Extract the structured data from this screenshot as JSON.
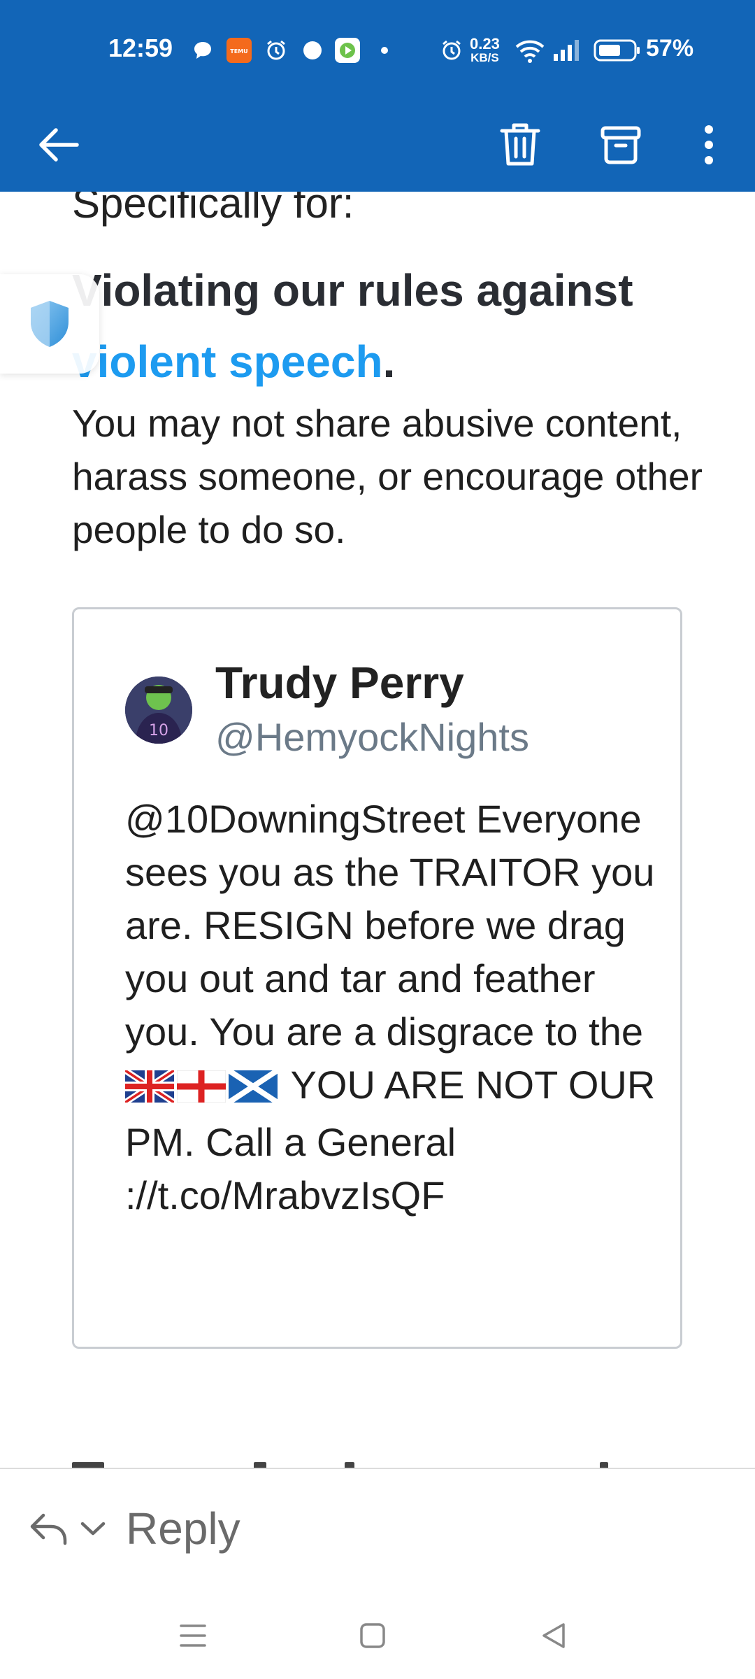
{
  "status_bar": {
    "time": "12:59",
    "net_speed_value": "0.23",
    "net_speed_unit": "KB/S",
    "battery_percent": "57%",
    "icons": [
      "chat-bubble-icon",
      "temu-app-icon",
      "alarm-icon",
      "circle-dot-icon",
      "video-app-icon",
      "dot-icon",
      "alarm-icon",
      "wifi-icon",
      "signal-icon",
      "battery-icon"
    ]
  },
  "toolbar": {
    "back_icon": "arrow-left-icon",
    "delete_icon": "trash-icon",
    "archive_icon": "archive-icon",
    "more_icon": "more-vertical-icon"
  },
  "email": {
    "clipped_heading": "Specifically for:",
    "rule_title_prefix": "Violating our rules against ",
    "rule_title_link": "violent speech",
    "rule_title_suffix": ".",
    "rule_description": "You may not share abusive content, harass someone, or encourage other people to do so."
  },
  "tweet": {
    "name": "Trudy Perry",
    "handle": "@HemyockNights",
    "text_part1": "@10DowningStreet Everyone sees you as the TRAITOR you are. RESIGN before we drag you out and tar and feather you. You are a disgrace to the ",
    "text_part2": " YOU ARE NOT OUR PM. Call a General ://t.co/MrabvzIsQF",
    "flags": [
      "uk-flag-icon",
      "england-flag-icon",
      "scotland-flag-icon"
    ]
  },
  "reply_bar": {
    "label": "Reply",
    "icon": "reply-icon",
    "chevron": "chevron-down-icon"
  },
  "nav_bar": {
    "buttons": [
      "menu-icon",
      "home-square-icon",
      "back-triangle-icon"
    ]
  },
  "colors": {
    "header_blue": "#1265b7",
    "link_blue": "#1d9bf0",
    "handle_gray": "#6b7a88"
  }
}
